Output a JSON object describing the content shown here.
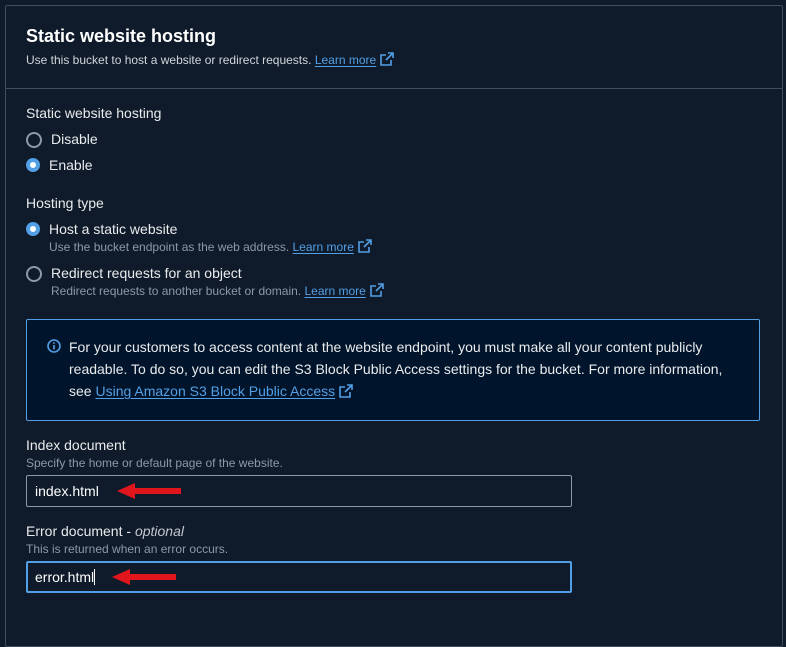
{
  "header": {
    "title": "Static website hosting",
    "description": "Use this bucket to host a website or redirect requests.",
    "learn_more": "Learn more"
  },
  "hosting": {
    "label": "Static website hosting",
    "options": [
      {
        "label": "Disable",
        "selected": false
      },
      {
        "label": "Enable",
        "selected": true
      }
    ]
  },
  "hosting_type": {
    "label": "Hosting type",
    "options": [
      {
        "label": "Host a static website",
        "description": "Use the bucket endpoint as the web address.",
        "learn_more": "Learn more",
        "selected": true
      },
      {
        "label": "Redirect requests for an object",
        "description": "Redirect requests to another bucket or domain.",
        "learn_more": "Learn more",
        "selected": false
      }
    ]
  },
  "alert": {
    "icon": "info-icon",
    "text": "For your customers to access content at the website endpoint, you must make all your content publicly readable. To do so, you can edit the S3 Block Public Access settings for the bucket. For more information, see",
    "link": "Using Amazon S3 Block Public Access"
  },
  "index_document": {
    "label": "Index document",
    "hint": "Specify the home or default page of the website.",
    "value": "index.html"
  },
  "error_document": {
    "label": "Error document",
    "optional": "optional",
    "hint": "This is returned when an error occurs.",
    "value": "error.html"
  },
  "colors": {
    "background": "#0f1b2a",
    "accent": "#539fe5",
    "annotation_arrow": "#e0161c"
  }
}
